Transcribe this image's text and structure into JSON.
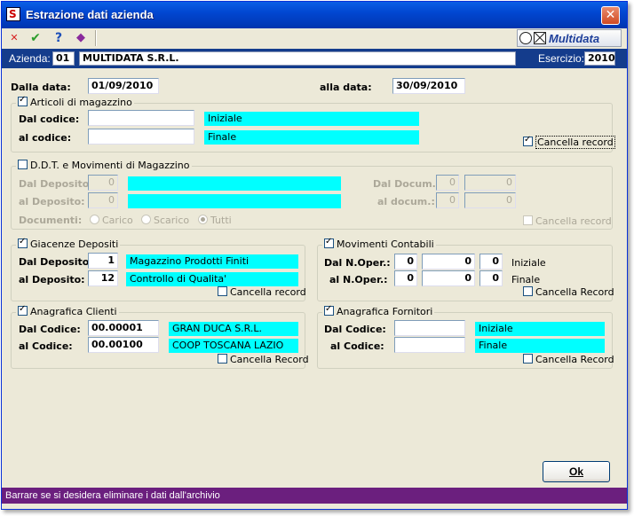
{
  "window": {
    "title": "Estrazione dati azienda",
    "close_glyph": "✕",
    "app_icon_letter": "S"
  },
  "toolbar": {
    "cancel_icon": "x-icon",
    "cancel_glyph": "✕",
    "confirm_icon": "check-icon",
    "confirm_glyph": "✔",
    "help_icon": "help-icon",
    "help_glyph": "?",
    "book_icon": "book-icon",
    "book_glyph": "◆"
  },
  "brand": {
    "logo_text": "Multidata"
  },
  "infobar": {
    "azienda_label": "Azienda:",
    "azienda_code": "01",
    "azienda_name": "MULTIDATA S.R.L.",
    "esercizio_label": "Esercizio:",
    "esercizio_value": "2010"
  },
  "dates": {
    "dalla_label": "Dalla data:",
    "dalla_value": "01/09/2010",
    "alla_label": "alla data:",
    "alla_value": "30/09/2010"
  },
  "articoli": {
    "title": "Articoli di magazzino",
    "checked": true,
    "dal_label": "Dal codice:",
    "dal_value": "",
    "dal_desc": "Iniziale",
    "al_label": "al codice:",
    "al_value": "",
    "al_desc": "Finale",
    "cancella_label": "Cancella record",
    "cancella_checked": true
  },
  "ddt": {
    "title": "D.D.T. e Movimenti di Magazzino",
    "checked": false,
    "dal_deposito_label": "Dal Deposito:",
    "dal_deposito_value": "0",
    "al_deposito_label": "al Deposito:",
    "al_deposito_value": "0",
    "dal_docum_label": "Dal Docum.:",
    "dal_docum_a": "0",
    "dal_docum_b": "0",
    "al_docum_label": "al docum.:",
    "al_docum_a": "0",
    "al_docum_b": "0",
    "documenti_label": "Documenti:",
    "radio_carico": "Carico",
    "radio_scarico": "Scarico",
    "radio_tutti": "Tutti",
    "cancella_label": "Cancella record"
  },
  "giacenze": {
    "title": "Giacenze Depositi",
    "checked": true,
    "dal_label": "Dal Deposito:",
    "dal_value": "1",
    "dal_desc": "Magazzino Prodotti Finiti",
    "al_label": "al Deposito:",
    "al_value": "12",
    "al_desc": "Controllo di Qualita'",
    "cancella_label": "Cancella record",
    "cancella_checked": false
  },
  "movimenti": {
    "title": "Movimenti Contabili",
    "checked": true,
    "dal_label": "Dal N.Oper.:",
    "dal_a": "0",
    "dal_b": "0",
    "dal_c": "0",
    "dal_desc": "Iniziale",
    "al_label": "al N.Oper.:",
    "al_a": "0",
    "al_b": "0",
    "al_c": "0",
    "al_desc": "Finale",
    "cancella_label": "Cancella Record",
    "cancella_checked": false
  },
  "clienti": {
    "title": "Anagrafica Clienti",
    "checked": true,
    "dal_label": "Dal Codice:",
    "dal_value": "00.00001",
    "dal_desc": "GRAN DUCA S.R.L.",
    "al_label": "al Codice:",
    "al_value": "00.00100",
    "al_desc": "COOP TOSCANA LAZIO",
    "cancella_label": "Cancella Record",
    "cancella_checked": false
  },
  "fornitori": {
    "title": "Anagrafica Fornitori",
    "checked": true,
    "dal_label": "Dal Codice:",
    "dal_value": "",
    "dal_desc": "Iniziale",
    "al_label": "al Codice:",
    "al_value": "",
    "al_desc": "Finale",
    "cancella_label": "Cancella Record",
    "cancella_checked": false
  },
  "buttons": {
    "ok_label": "Ok"
  },
  "status": {
    "text": "Barrare se si desidera eliminare i dati dall'archivio"
  },
  "colors": {
    "highlight": "#00ffff",
    "infobar": "#143c8c",
    "statusbar": "#6b1f7e",
    "titlebar": "#0147d1"
  }
}
